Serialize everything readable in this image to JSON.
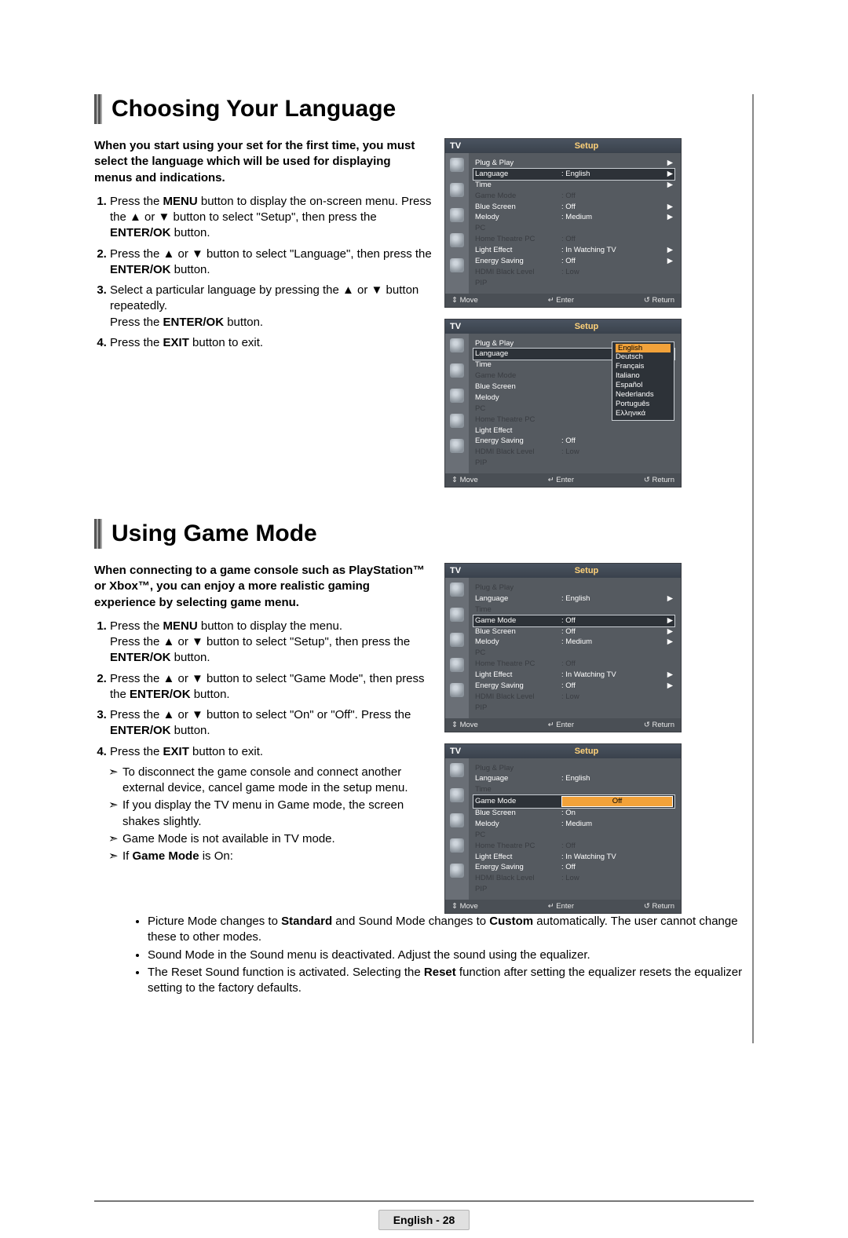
{
  "section1": {
    "heading": "Choosing Your Language",
    "intro": "When you start using your set for the first time, you must select the language which will be used for displaying menus and indications.",
    "steps": [
      "Press the <b>MENU</b> button to display the on-screen menu. Press the ▲ or ▼ button to select \"Setup\", then press the <b>ENTER/OK</b> button.",
      "Press the ▲ or ▼ button to select \"Language\", then press the <b>ENTER/OK</b> button.",
      "Select a particular language by pressing the ▲ or ▼ button repeatedly.<br>Press the <b>ENTER/OK</b> button.",
      "Press the <b>EXIT</b> button to exit."
    ]
  },
  "section2": {
    "heading": "Using Game Mode",
    "intro": "When connecting to a game console such as PlayStation™ or Xbox™, you can enjoy a more realistic gaming experience by selecting game menu.",
    "steps": [
      "Press the <b>MENU</b> button to display the menu.<br>Press the ▲ or ▼ button to select \"Setup\", then press the <b>ENTER/OK</b> button.",
      "Press the ▲ or ▼ button to select \"Game Mode\", then press the <b>ENTER/OK</b> button.",
      "Press the ▲ or ▼ button to select \"On\" or \"Off\". Press the <b>ENTER/OK</b> button.",
      "Press the <b>EXIT</b> button to exit."
    ],
    "arrows": [
      "To disconnect the game console and connect another external device, cancel game mode in the setup menu.",
      "If you display the TV menu in Game mode, the screen shakes slightly.",
      "Game Mode is not available in TV mode.",
      "If <b>Game Mode</b> is On:"
    ],
    "sub_bullets": [
      "Picture Mode changes to <b>Standard</b> and Sound Mode changes to <b>Custom</b> automatically. The user cannot change these to other modes.",
      "Sound Mode in the Sound menu is deactivated. Adjust the sound using the equalizer.",
      "The Reset Sound function is activated. Selecting the <b>Reset</b> function after setting the equalizer resets the equalizer setting to the factory defaults."
    ]
  },
  "osd_common": {
    "tv": "TV",
    "title": "Setup",
    "footer_move": "Move",
    "footer_enter": "Enter",
    "footer_return": "Return",
    "move_glyph": "⇕",
    "enter_glyph": "↵",
    "return_glyph": "↺"
  },
  "osd1_rows": [
    {
      "lbl": "Plug & Play",
      "val": "",
      "caret": "▶",
      "dim": false,
      "hi": false
    },
    {
      "lbl": "Language",
      "val": ": English",
      "caret": "▶",
      "dim": false,
      "hi": true
    },
    {
      "lbl": "Time",
      "val": "",
      "caret": "▶",
      "dim": false,
      "hi": false
    },
    {
      "lbl": "Game Mode",
      "val": ": Off",
      "caret": "",
      "dim": true,
      "hi": false
    },
    {
      "lbl": "Blue Screen",
      "val": ": Off",
      "caret": "▶",
      "dim": false,
      "hi": false
    },
    {
      "lbl": "Melody",
      "val": ": Medium",
      "caret": "▶",
      "dim": false,
      "hi": false
    },
    {
      "lbl": "PC",
      "val": "",
      "caret": "",
      "dim": true,
      "hi": false
    },
    {
      "lbl": "Home Theatre PC",
      "val": ": Off",
      "caret": "",
      "dim": true,
      "hi": false
    },
    {
      "lbl": "Light Effect",
      "val": ": In Watching TV",
      "caret": "▶",
      "dim": false,
      "hi": false
    },
    {
      "lbl": "Energy Saving",
      "val": ": Off",
      "caret": "▶",
      "dim": false,
      "hi": false
    },
    {
      "lbl": "HDMI Black Level",
      "val": ": Low",
      "caret": "",
      "dim": true,
      "hi": false
    },
    {
      "lbl": "PIP",
      "val": "",
      "caret": "",
      "dim": true,
      "hi": false
    }
  ],
  "osd2_left": [
    {
      "lbl": "Plug & Play",
      "dim": false
    },
    {
      "lbl": "Language",
      "dim": false,
      "hi": true
    },
    {
      "lbl": "Time",
      "dim": false
    },
    {
      "lbl": "Game Mode",
      "dim": true
    },
    {
      "lbl": "Blue Screen",
      "dim": false
    },
    {
      "lbl": "Melody",
      "dim": false
    },
    {
      "lbl": "PC",
      "dim": true
    },
    {
      "lbl": "Home Theatre PC",
      "dim": true
    },
    {
      "lbl": "Light Effect",
      "dim": false
    },
    {
      "lbl": "Energy Saving",
      "dim": false
    },
    {
      "lbl": "HDMI Black Level",
      "dim": true
    },
    {
      "lbl": "PIP",
      "dim": true
    }
  ],
  "osd2_left_vals": {
    "9": ": Off",
    "10": ": Low"
  },
  "osd2_lang_options": [
    "English",
    "Deutsch",
    "Français",
    "Italiano",
    "Español",
    "Nederlands",
    "Português",
    "Ελληνικά"
  ],
  "osd3_rows": [
    {
      "lbl": "Plug & Play",
      "val": "",
      "caret": "",
      "dim": true,
      "hi": false
    },
    {
      "lbl": "Language",
      "val": ": English",
      "caret": "▶",
      "dim": false,
      "hi": false
    },
    {
      "lbl": "Time",
      "val": "",
      "caret": "",
      "dim": true,
      "hi": false
    },
    {
      "lbl": "Game Mode",
      "val": ": Off",
      "caret": "▶",
      "dim": false,
      "hi": true
    },
    {
      "lbl": "Blue Screen",
      "val": ": Off",
      "caret": "▶",
      "dim": false,
      "hi": false
    },
    {
      "lbl": "Melody",
      "val": ": Medium",
      "caret": "▶",
      "dim": false,
      "hi": false
    },
    {
      "lbl": "PC",
      "val": "",
      "caret": "",
      "dim": true,
      "hi": false
    },
    {
      "lbl": "Home Theatre PC",
      "val": ": Off",
      "caret": "",
      "dim": true,
      "hi": false
    },
    {
      "lbl": "Light Effect",
      "val": ": In Watching TV",
      "caret": "▶",
      "dim": false,
      "hi": false
    },
    {
      "lbl": "Energy Saving",
      "val": ": Off",
      "caret": "▶",
      "dim": false,
      "hi": false
    },
    {
      "lbl": "HDMI Black Level",
      "val": ": Low",
      "caret": "",
      "dim": true,
      "hi": false
    },
    {
      "lbl": "PIP",
      "val": "",
      "caret": "",
      "dim": true,
      "hi": false
    }
  ],
  "osd4_rows": [
    {
      "lbl": "Plug & Play",
      "val": "",
      "caret": "",
      "dim": true,
      "hi": false
    },
    {
      "lbl": "Language",
      "val": ": English",
      "caret": "",
      "dim": false,
      "hi": false
    },
    {
      "lbl": "Time",
      "val": "",
      "caret": "",
      "dim": true,
      "hi": false
    },
    {
      "lbl": "Game Mode",
      "val": "Off",
      "caret": "",
      "dim": false,
      "hi": true,
      "sel": true
    },
    {
      "lbl": "Blue Screen",
      "val": ": On",
      "caret": "",
      "dim": false,
      "hi": false,
      "boxed": true
    },
    {
      "lbl": "Melody",
      "val": ": Medium",
      "caret": "",
      "dim": false,
      "hi": false
    },
    {
      "lbl": "PC",
      "val": "",
      "caret": "",
      "dim": true,
      "hi": false
    },
    {
      "lbl": "Home Theatre PC",
      "val": ": Off",
      "caret": "",
      "dim": true,
      "hi": false
    },
    {
      "lbl": "Light Effect",
      "val": ": In Watching TV",
      "caret": "",
      "dim": false,
      "hi": false
    },
    {
      "lbl": "Energy Saving",
      "val": ": Off",
      "caret": "",
      "dim": false,
      "hi": false
    },
    {
      "lbl": "HDMI Black Level",
      "val": ": Low",
      "caret": "",
      "dim": true,
      "hi": false
    },
    {
      "lbl": "PIP",
      "val": "",
      "caret": "",
      "dim": true,
      "hi": false
    }
  ],
  "footer": "English - 28"
}
